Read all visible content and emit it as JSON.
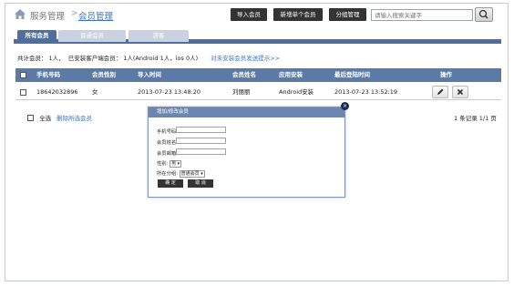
{
  "header": {
    "breadcrumb_root": "服务管理",
    "breadcrumb_sep": ">",
    "breadcrumb_current": "会员管理",
    "buttons": {
      "import": "导入会员",
      "add_single": "新增单个会员",
      "group_manage": "分组管理"
    },
    "search_placeholder": "请输入搜索关键字"
  },
  "tabs": [
    {
      "label": "所有会员",
      "active": true
    },
    {
      "label": "普通会员",
      "active": false
    },
    {
      "label": "游客",
      "active": false
    }
  ],
  "summary": {
    "total_label": "共计会员：",
    "total_value": "1人，",
    "installed_label": "已安装客户端会员：",
    "installed_value": "1人(Android 1人，ios 0人)",
    "send_link": "对未安装会员发送提示>>"
  },
  "table": {
    "columns": [
      "手机号码",
      "会员性别",
      "导入时间",
      "会员姓名",
      "应用安装",
      "最后登陆时间",
      "操作"
    ],
    "rows": [
      {
        "phone": "18642032896",
        "gender": "女",
        "import_time": "2013-07-23 13:48:20",
        "name": "刘丽丽",
        "install": "Android安装",
        "last_login": "2013-07-23 13:52:19"
      }
    ]
  },
  "footer": {
    "select_all": "全选",
    "delete_selected": "删除所选会员",
    "records": "1 条记录 1/1 页"
  },
  "modal": {
    "title": "增加/修改会员",
    "fields": {
      "phone": "手机号码:",
      "name": "会员姓名:",
      "email": "会员邮箱:",
      "gender": "性别:",
      "group": "所在分组:"
    },
    "gender_value": "男",
    "group_value": "普通会员",
    "confirm": "确 定",
    "cancel": "取 消"
  },
  "icons": {
    "home": "home-icon",
    "search": "search-icon",
    "edit": "pencil-icon",
    "delete": "close-icon"
  },
  "colors": {
    "accent": "#4e6e9b",
    "table_header": "#5b7aa6",
    "link": "#3a73c8"
  }
}
